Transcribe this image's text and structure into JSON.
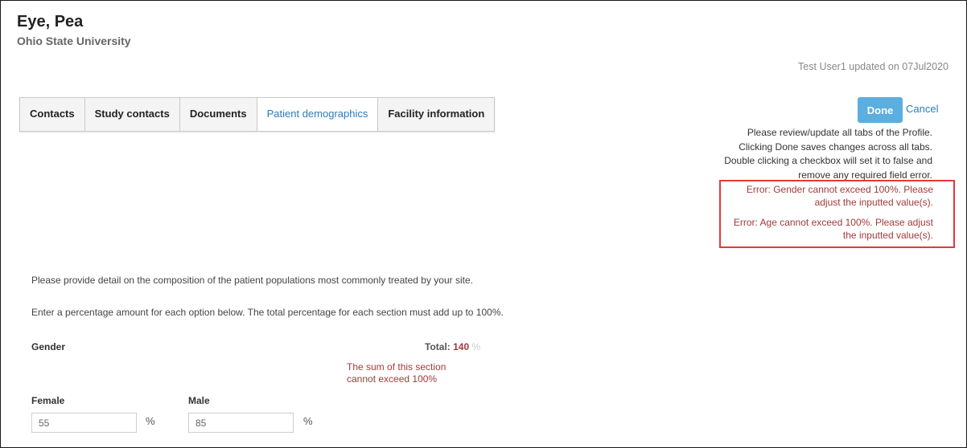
{
  "profile": {
    "name": "Eye, Pea",
    "organization": "Ohio State University",
    "updated_text": "Test User1 updated on 07Jul2020"
  },
  "tabs": [
    {
      "label": "Contacts",
      "active": false
    },
    {
      "label": "Study contacts",
      "active": false
    },
    {
      "label": "Documents",
      "active": false
    },
    {
      "label": "Patient demographics",
      "active": true
    },
    {
      "label": "Facility information",
      "active": false
    }
  ],
  "actions": {
    "done_label": "Done",
    "cancel_label": "Cancel"
  },
  "info_lines": [
    "Please review/update all tabs of the Profile.",
    "Clicking Done saves changes across all tabs.",
    "Double clicking a checkbox will set it to false and",
    "remove any required field error."
  ],
  "errors": [
    [
      "Error: Gender cannot exceed 100%. Please",
      "adjust the inputted value(s)."
    ],
    [
      "Error: Age cannot exceed 100%. Please adjust",
      "the inputted value(s)."
    ]
  ],
  "instructions": {
    "composition": "Please provide detail on the composition of the patient populations most commonly treated by your site.",
    "percentage": "Enter a percentage amount for each option below. The total percentage for each section must add up to 100%."
  },
  "gender_section": {
    "title": "Gender",
    "total_label": "Total:",
    "total_value": "140",
    "total_unit": "%",
    "sum_error_lines": [
      "The sum of this section",
      "cannot exceed 100%"
    ],
    "fields": [
      {
        "label": "Female",
        "value": "55",
        "unit": "%"
      },
      {
        "label": "Male",
        "value": "85",
        "unit": "%"
      }
    ]
  },
  "colors": {
    "accent": "#2a7bbd",
    "done_button": "#5aaee0",
    "error_text": "#a13b3b",
    "error_box": "#e13a3a"
  }
}
